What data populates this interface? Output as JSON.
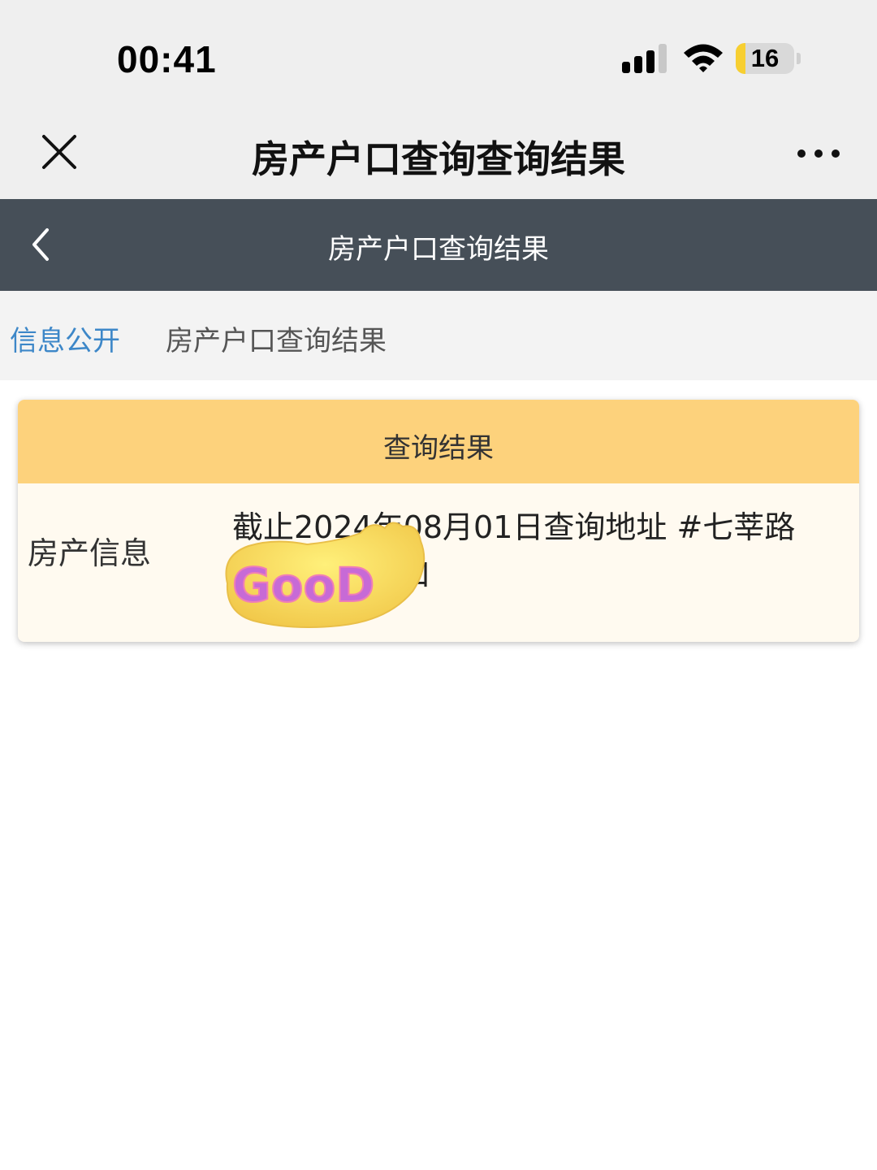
{
  "status_bar": {
    "time": "00:41",
    "battery": "16",
    "battery_percent": 16
  },
  "top_nav": {
    "title": "房产户口查询查询结果"
  },
  "page_header": {
    "title": "房产户口查询结果"
  },
  "breadcrumb": {
    "link": "信息公开",
    "current": "房产户口查询结果"
  },
  "result_card": {
    "header": "查询结果",
    "row_label": "房产信息",
    "row_value": "截止2024年08月01日查询地址 #七莘路 01室# 无户口"
  },
  "sticker": {
    "text": "GooD"
  },
  "colors": {
    "accent_link": "#3d87c8",
    "header_dark": "#464f58",
    "card_header": "#fdd27c",
    "card_body": "#fffaf0",
    "battery_fill": "#f7cf31"
  }
}
